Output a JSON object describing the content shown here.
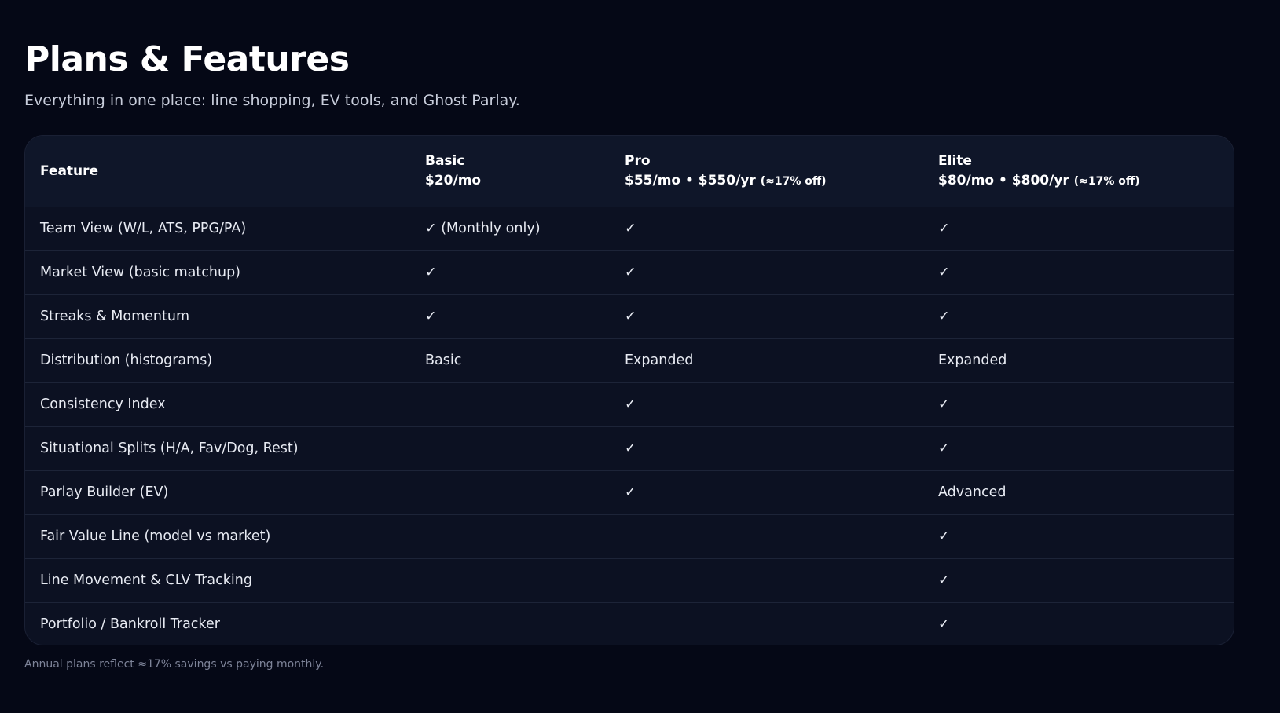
{
  "header": {
    "title": "Plans & Features",
    "subtitle": "Everything in one place: line shopping, EV tools, and Ghost Parlay."
  },
  "table": {
    "feature_header": "Feature",
    "plans": [
      {
        "name": "Basic",
        "price": "$20/mo",
        "savings": ""
      },
      {
        "name": "Pro",
        "price": "$55/mo • $550/yr",
        "savings": "(≈17% off)"
      },
      {
        "name": "Elite",
        "price": "$80/mo • $800/yr",
        "savings": "(≈17% off)"
      }
    ],
    "rows": [
      {
        "feature": "Team View (W/L, ATS, PPG/PA)",
        "basic": "✓ (Monthly only)",
        "pro": "✓",
        "elite": "✓"
      },
      {
        "feature": "Market View (basic matchup)",
        "basic": "✓",
        "pro": "✓",
        "elite": "✓"
      },
      {
        "feature": "Streaks & Momentum",
        "basic": "✓",
        "pro": "✓",
        "elite": "✓"
      },
      {
        "feature": "Distribution (histograms)",
        "basic": "Basic",
        "pro": "Expanded",
        "elite": "Expanded"
      },
      {
        "feature": "Consistency Index",
        "basic": "",
        "pro": "✓",
        "elite": "✓"
      },
      {
        "feature": "Situational Splits (H/A, Fav/Dog, Rest)",
        "basic": "",
        "pro": "✓",
        "elite": "✓"
      },
      {
        "feature": "Parlay Builder (EV)",
        "basic": "",
        "pro": "✓",
        "elite": "Advanced"
      },
      {
        "feature": "Fair Value Line (model vs market)",
        "basic": "",
        "pro": "",
        "elite": "✓"
      },
      {
        "feature": "Line Movement & CLV Tracking",
        "basic": "",
        "pro": "",
        "elite": "✓"
      },
      {
        "feature": "Portfolio / Bankroll Tracker",
        "basic": "",
        "pro": "",
        "elite": "✓"
      }
    ]
  },
  "footnote": "Annual plans reflect ≈17% savings vs paying monthly."
}
